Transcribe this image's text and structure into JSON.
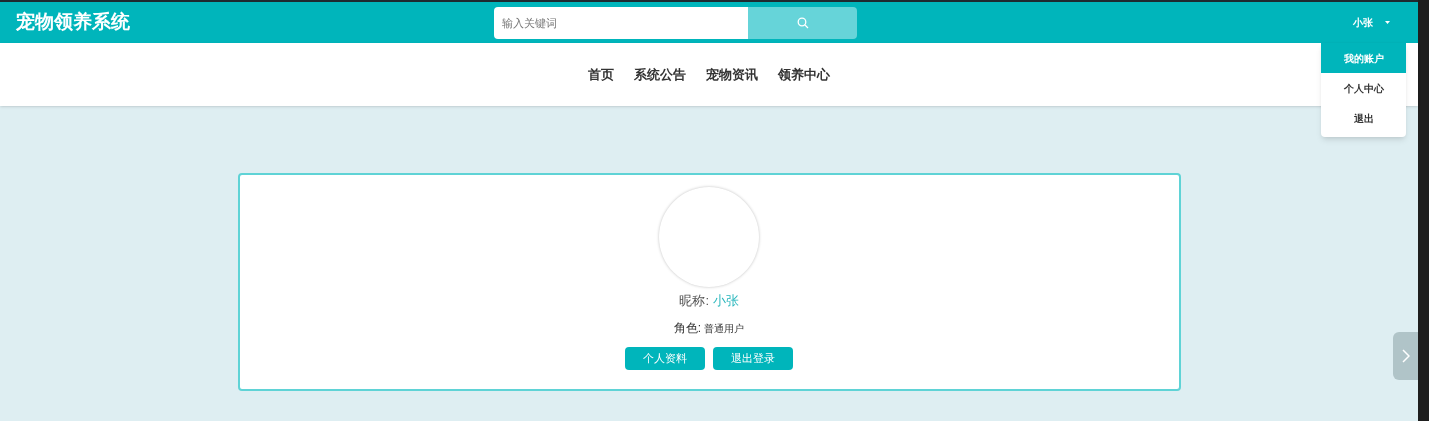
{
  "header": {
    "logo": "宠物领养系统",
    "search": {
      "placeholder": "输入关键词"
    },
    "user": "小张"
  },
  "user_menu": [
    {
      "label": "我的账户",
      "selected": true
    },
    {
      "label": "个人中心",
      "selected": false
    },
    {
      "label": "退出",
      "selected": false
    }
  ],
  "nav": [
    {
      "label": "首页"
    },
    {
      "label": "系统公告"
    },
    {
      "label": "宠物资讯"
    },
    {
      "label": "领养中心"
    }
  ],
  "profile": {
    "nickname_label": "昵称:",
    "nickname": "小张",
    "role_label": "角色:",
    "role": "普通用户",
    "buttons": [
      "个人资料",
      "退出登录"
    ]
  }
}
